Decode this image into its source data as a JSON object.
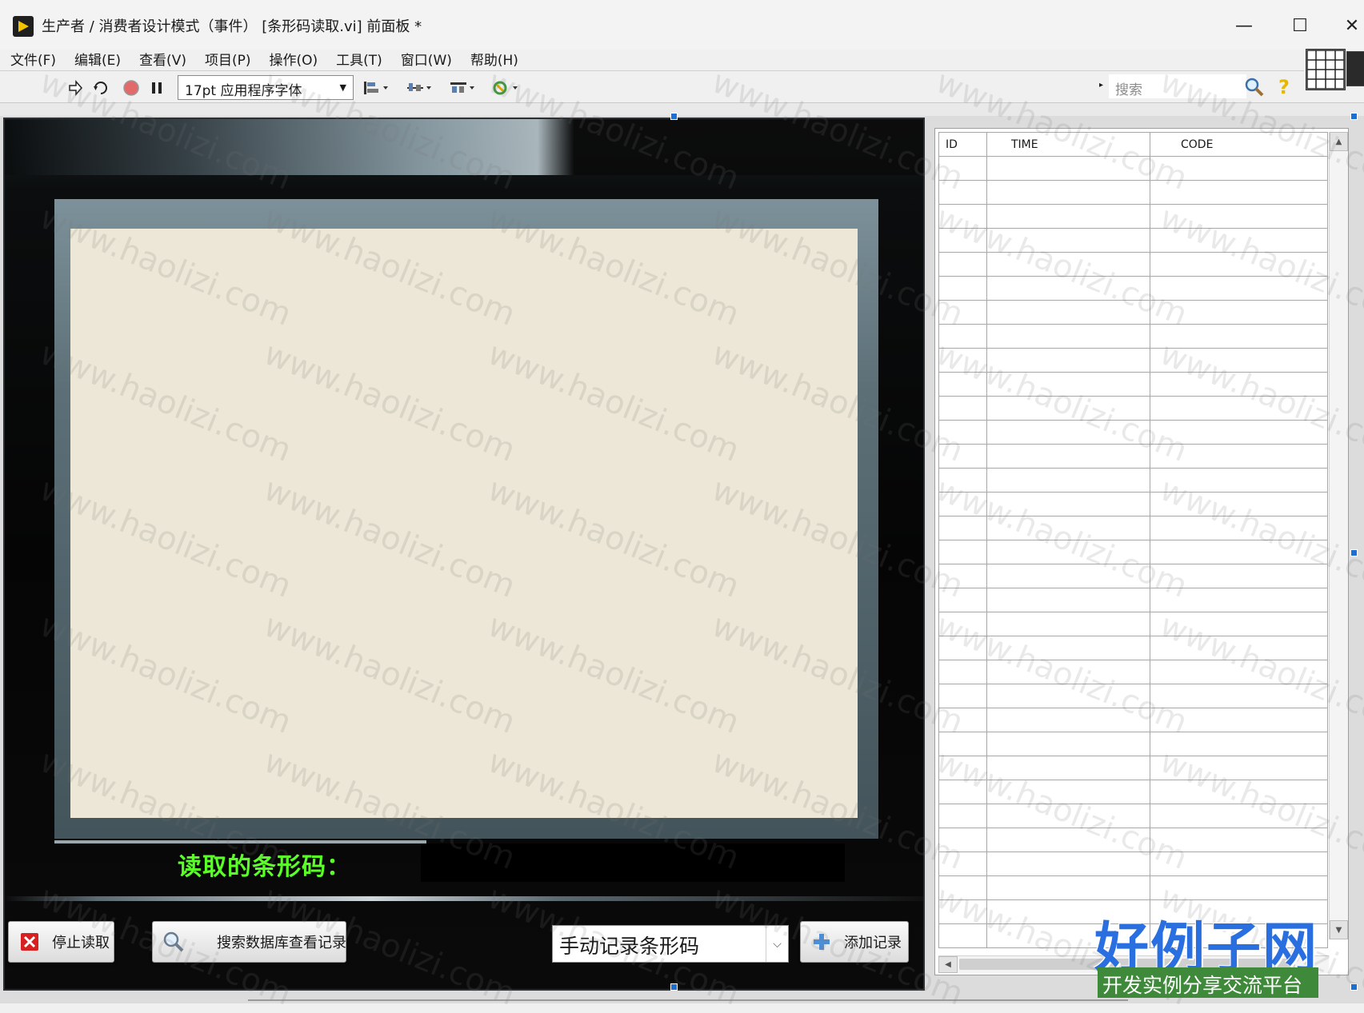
{
  "window": {
    "title": "生产者 / 消费者设计模式（事件） [条形码读取.vi] 前面板 *",
    "min_glyph": "—",
    "max_glyph": "☐",
    "close_glyph": "✕"
  },
  "menubar": {
    "items": [
      {
        "label": "文件(F)"
      },
      {
        "label": "编辑(E)"
      },
      {
        "label": "查看(V)"
      },
      {
        "label": "项目(P)"
      },
      {
        "label": "操作(O)"
      },
      {
        "label": "工具(T)"
      },
      {
        "label": "窗口(W)"
      },
      {
        "label": "帮助(H)"
      }
    ]
  },
  "toolbar": {
    "icons": [
      "run-arrow-icon",
      "run-continuously-icon",
      "abort-icon",
      "pause-icon",
      "align-objects-icon",
      "distribute-objects-icon",
      "resize-objects-icon",
      "reorder-icon"
    ],
    "font_label": "17pt 应用程序字体",
    "search_placeholder": "搜索",
    "help_glyph": "?"
  },
  "display": {
    "barcode_label": "读取的条形码：",
    "barcode_value": ""
  },
  "controls": {
    "stop_label": "停止读取",
    "search_db_label": "搜索数据库查看记录",
    "manual_select_value": "手动记录条形码",
    "add_label": "添加记录"
  },
  "table": {
    "columns": [
      "ID",
      "TIME",
      "CODE"
    ],
    "row_count": 33
  },
  "watermark": {
    "text": "www.haolizi.com",
    "logo_title": "好例子网",
    "logo_subtitle": "开发实例分享交流平台"
  },
  "colors": {
    "accent_green": "#59ff27",
    "image_area": "#ece7d6",
    "selection_blue": "#1d6fd8",
    "logo_blue": "#2a6fe0",
    "logo_green": "#3f8a3a"
  }
}
